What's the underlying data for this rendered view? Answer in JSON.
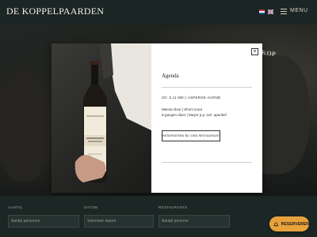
{
  "header": {
    "logo": "DE KOPPELPAARDEN",
    "menu_label": "MENU",
    "languages": [
      "NL",
      "EN"
    ]
  },
  "background": {
    "sign_text": "DE KOP"
  },
  "modal": {
    "title": "Agenda",
    "event_line": "ZO. 6.11 MEI | ASPERGE-AVOND",
    "description_lines": [
      "Meesa shoe | Short score",
      "8-gangen diner | Meyer p.p. incl. aperitief"
    ],
    "reserve_label": "RESERVEREN BIJ ONS RESTAURANT",
    "close_label": "×"
  },
  "form": {
    "fields": [
      {
        "label": "AANTAL",
        "value": "Aantal personen"
      },
      {
        "label": "DATUM",
        "value": "Selecteer datum"
      },
      {
        "label": "RESTAURANTS",
        "value": "Aantal persone"
      }
    ]
  },
  "reserve_button": {
    "label": "RESERVEREN"
  },
  "colors": {
    "accent": "#e8a23c",
    "header_bg": "#1b2523",
    "form_bg": "#1c2624"
  }
}
